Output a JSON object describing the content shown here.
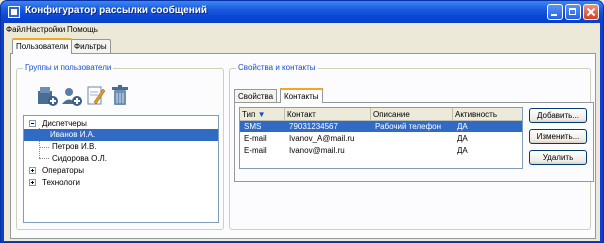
{
  "window": {
    "title": "Конфигуратор рассылки сообщений"
  },
  "menu": [
    "Файл",
    "Настройки",
    "Помощь"
  ],
  "main_tabs": [
    {
      "label": "Пользователи",
      "active": true
    },
    {
      "label": "Фильтры",
      "active": false
    }
  ],
  "left_group": {
    "legend": "Группы и пользователи",
    "toolbar": [
      "add-group-icon",
      "add-user-icon",
      "edit-icon",
      "delete-icon"
    ],
    "tree": [
      {
        "label": "Диспетчеры",
        "expanded": true
      },
      {
        "label": "Иванов И.А.",
        "selected": true
      },
      {
        "label": "Петров И.В."
      },
      {
        "label": "Сидорова О.Л."
      },
      {
        "label": "Операторы",
        "expanded": false
      },
      {
        "label": "Технологи",
        "expanded": false
      }
    ]
  },
  "right_group": {
    "legend": "Свойства и контакты",
    "tabs": [
      {
        "label": "Свойства",
        "active": false
      },
      {
        "label": "Контакты",
        "active": true
      }
    ],
    "table": {
      "columns": [
        "Тип",
        "Контакт",
        "Описание",
        "Активность"
      ],
      "rows": [
        {
          "type": "SMS",
          "contact": "79031234567",
          "description": "Рабочий телефон",
          "active": "ДА",
          "selected": true
        },
        {
          "type": "E-mail",
          "contact": "Ivanov_A@mail.ru",
          "description": "",
          "active": "ДА"
        },
        {
          "type": "E-mail",
          "contact": "Ivanov@mail.ru",
          "description": "",
          "active": "ДА"
        }
      ]
    },
    "buttons": {
      "add": "Добавить...",
      "edit": "Изменить...",
      "delete": "Удалить"
    }
  },
  "colors": {
    "title_bar": "#0b46d4",
    "selection": "#316ac5",
    "tab_accent": "#f5a623",
    "group_legend": "#1a4fc9"
  }
}
